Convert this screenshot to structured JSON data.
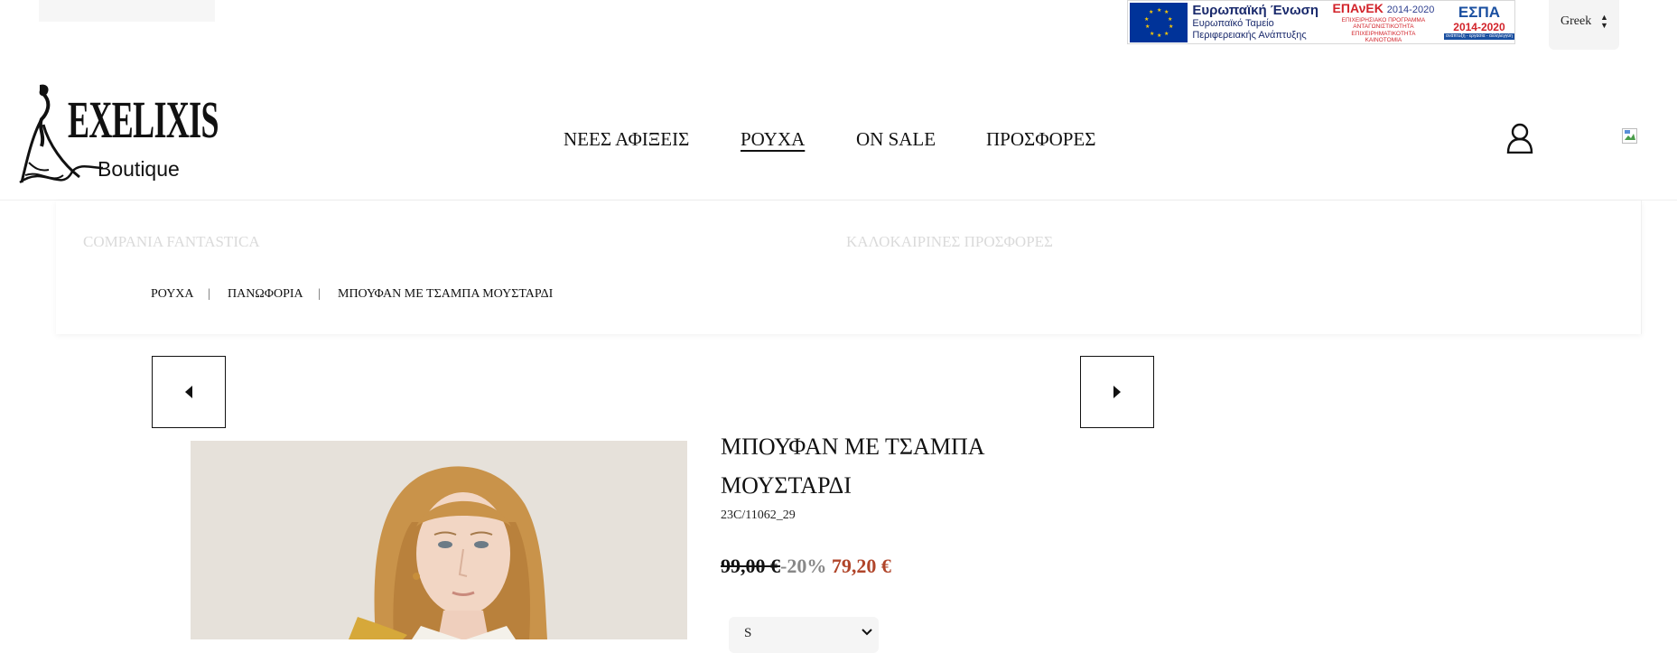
{
  "eu_banner": {
    "eu_line1": "Ευρωπαϊκή Ένωση",
    "eu_line2": "Ευρωπαϊκό Ταμείο",
    "eu_line3": "Περιφερειακής Ανάπτυξης",
    "epanek_title": "ΕΠΑνΕΚ",
    "epanek_years": "2014-2020",
    "epanek_line1": "ΕΠΙΧΕΙΡΗΣΙΑΚΟ ΠΡΟΓΡΑΜΜΑ",
    "epanek_line2": "ΑΝΤΑΓΩΝΙΣΤΙΚΟΤΗΤΑ",
    "epanek_line3": "ΕΠΙΧΕΙΡΗΜΑΤΙΚΟΤΗΤΑ",
    "epanek_line4": "ΚΑΙΝΟΤΟΜΙΑ",
    "espa_title": "ΕΣΠΑ",
    "espa_years": "2014-2020",
    "espa_slogan": "ανάπτυξη - εργασία - αλληλεγγύη"
  },
  "language": {
    "selected": "Greek"
  },
  "logo": {
    "word": "EXELIXIS",
    "sub": "Boutique"
  },
  "nav": {
    "items": [
      {
        "label": "ΝΕΕΣ ΑΦΙΞΕΙΣ"
      },
      {
        "label": "ΡΟΥΧΑ"
      },
      {
        "label": "ON SALE"
      },
      {
        "label": "ΠΡΟΣΦΟΡΕΣ"
      }
    ]
  },
  "mega_menu": {
    "left_link": "COMPANIA FANTASTICA",
    "right_link": "ΚΑΛΟΚΑΙΡΙΝΕΣ ΠΡΟΣΦΟΡΕΣ"
  },
  "breadcrumb": {
    "items": [
      "ΡΟΥΧΑ",
      "ΠΑΝΩΦΟΡΙΑ",
      "ΜΠΟΥΦΑΝ ΜΕ ΤΣΑΜΠΑ ΜΟΥΣΤΑΡΔΙ"
    ],
    "separator": "|"
  },
  "product": {
    "title_line1": "ΜΠΟΥΦΑΝ ΜΕ ΤΣΑΜΠΑ",
    "title_line2": "ΜΟΥΣΤΑΡΔΙ",
    "sku": "23C/11062_29",
    "old_price": "99,00 €",
    "discount": "-20%",
    "new_price": "79,20 €",
    "size_selected": "S"
  },
  "colors": {
    "accent_price": "#b0452a",
    "discount_gray": "#888888",
    "text": "#111111"
  }
}
